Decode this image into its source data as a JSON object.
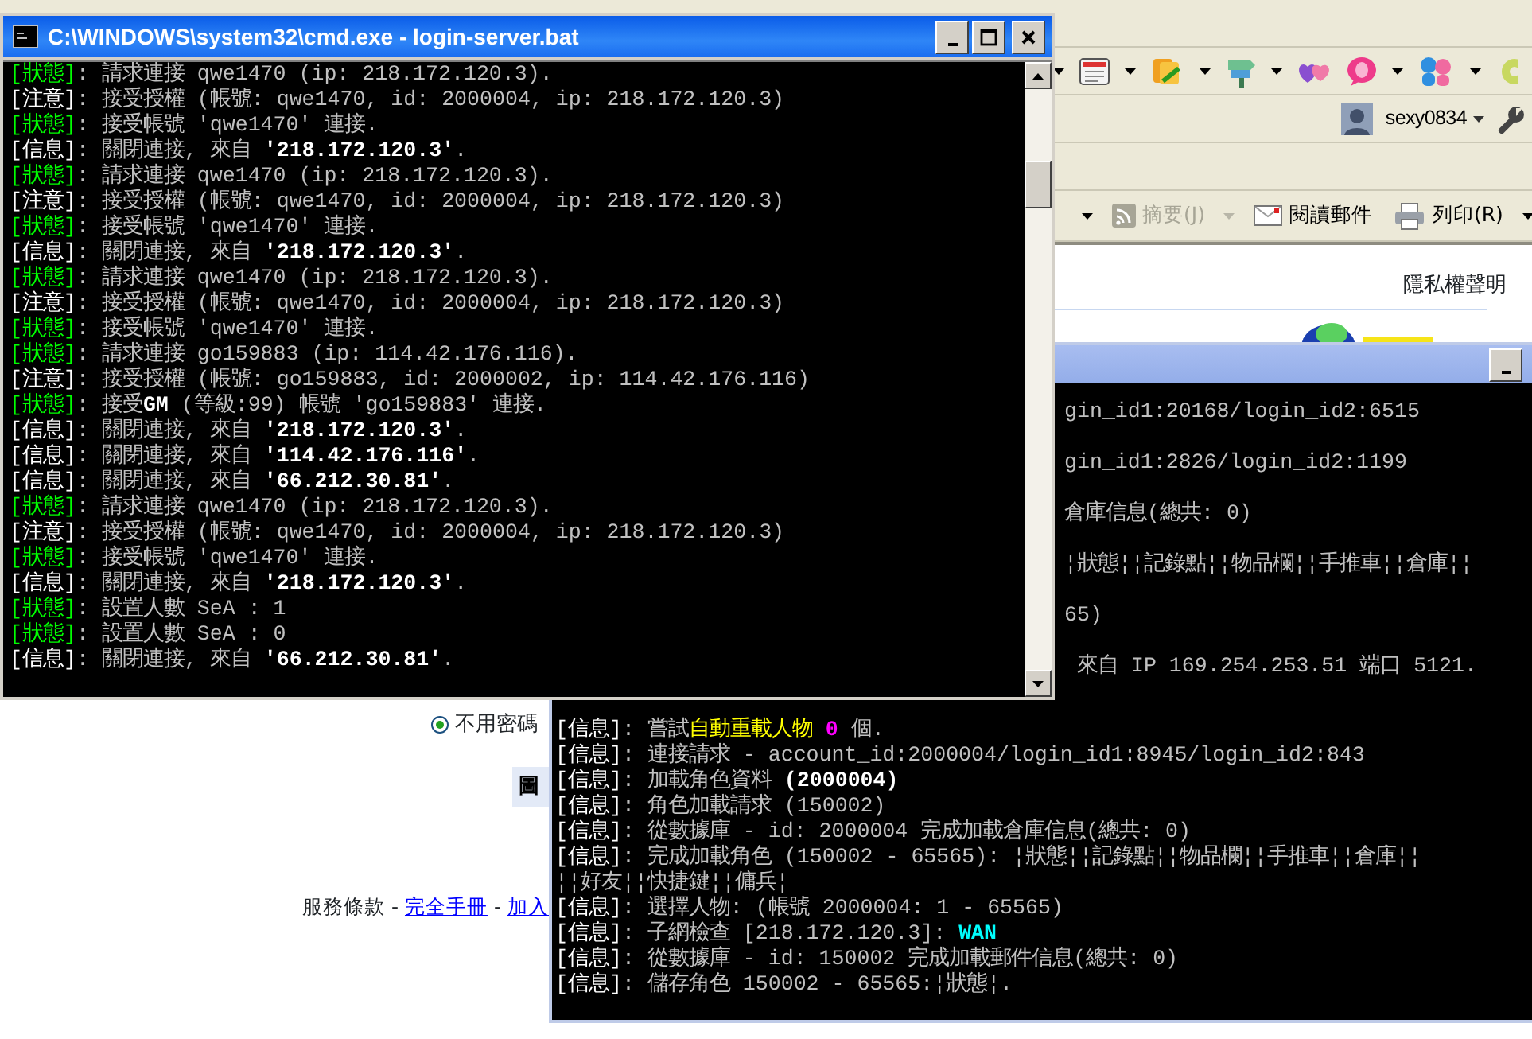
{
  "browser": {
    "user": "sexy0834",
    "commands": [
      {
        "label": "摘要(J)",
        "disabled": true
      },
      {
        "label": "閱讀郵件",
        "disabled": false
      },
      {
        "label": "列印(R)",
        "disabled": false
      }
    ],
    "privacy_link": "隱私權聲明",
    "login_option": {
      "label": "不用密碼",
      "selected": true
    },
    "button_fragment": "圖",
    "footer": {
      "separator": "-",
      "items": [
        {
          "text": "服務條款",
          "kind": "text"
        },
        {
          "text": "完全手冊",
          "kind": "link"
        },
        {
          "text": "加入",
          "kind": "link"
        }
      ]
    }
  },
  "console_back": {
    "active": false,
    "fragments": [
      "gin_id1:20168/login_id2:6515",
      "gin_id1:2826/login_id2:1199",
      "倉庫信息(總共: 0)",
      "¦狀態¦¦記錄點¦¦物品欄¦¦手推車¦¦倉庫¦¦",
      "65)",
      " 來自 IP 169.254.253.51 端口 5121."
    ],
    "lines": [
      {
        "tag": "[信息]",
        "kind": "info",
        "parts": [
          {
            "text": ": 嘗試"
          },
          {
            "text": "自動重載人物 ",
            "color": "#ffff00"
          },
          {
            "text": "0",
            "color": "#ff00ff",
            "bold": true
          },
          {
            "text": " 個."
          }
        ]
      },
      {
        "tag": "[信息]",
        "kind": "info",
        "parts": [
          {
            "text": ": 連接請求 - account_id:2000004/login_id1:8945/login_id2:843"
          }
        ]
      },
      {
        "tag": "[信息]",
        "kind": "info",
        "parts": [
          {
            "text": ": 加載角色資料 "
          },
          {
            "text": "(2000004)",
            "color": "#ffffff",
            "bold": true
          }
        ]
      },
      {
        "tag": "[信息]",
        "kind": "info",
        "parts": [
          {
            "text": ": 角色加載請求 (150002)"
          }
        ]
      },
      {
        "tag": "[信息]",
        "kind": "info",
        "parts": [
          {
            "text": ": 從數據庫 - id: 2000004 完成加載倉庫信息(總共: 0)"
          }
        ]
      },
      {
        "tag": "[信息]",
        "kind": "info",
        "parts": [
          {
            "text": ": 完成加載角色 (150002 - 65565): ¦狀態¦¦記錄點¦¦物品欄¦¦手推車¦¦倉庫¦¦"
          }
        ]
      },
      {
        "kind": "wrap",
        "parts": [
          {
            "text": "¦¦好友¦¦快捷鍵¦¦傭兵¦"
          }
        ]
      },
      {
        "tag": "[信息]",
        "kind": "info",
        "parts": [
          {
            "text": ": 選擇人物: (帳號 2000004: 1 - 65565)"
          }
        ]
      },
      {
        "tag": "[信息]",
        "kind": "info",
        "parts": [
          {
            "text": ": 子網檢查 [218.172.120.3]: "
          },
          {
            "text": "WAN",
            "color": "#00ffff",
            "bold": true
          }
        ]
      },
      {
        "tag": "[信息]",
        "kind": "info",
        "parts": [
          {
            "text": ": 從數據庫 - id: 150002 完成加載郵件信息(總共: 0)"
          }
        ]
      },
      {
        "tag": "[信息]",
        "kind": "info",
        "parts": [
          {
            "text": ": 儲存角色 150002 - 65565:¦狀態¦."
          }
        ]
      }
    ]
  },
  "console_front": {
    "title": "C:\\WINDOWS\\system32\\cmd.exe - login-server.bat",
    "active": true,
    "lines": [
      {
        "tag": "[狀態]",
        "kind": "status",
        "parts": [
          {
            "text": ": 請求連接 qwe1470 (ip: 218.172.120.3)."
          }
        ]
      },
      {
        "tag": "[注意]",
        "kind": "notice",
        "parts": [
          {
            "text": ": 接受授權 (帳號: qwe1470, id: 2000004, ip: 218.172.120.3)"
          }
        ]
      },
      {
        "tag": "[狀態]",
        "kind": "status",
        "parts": [
          {
            "text": ": 接受帳號 'qwe1470' 連接."
          }
        ]
      },
      {
        "tag": "[信息]",
        "kind": "info",
        "parts": [
          {
            "text": ": 關閉連接, 來自 "
          },
          {
            "text": "'218.172.120.3'",
            "color": "#ffffff",
            "bold": true
          },
          {
            "text": "."
          }
        ]
      },
      {
        "tag": "[狀態]",
        "kind": "status",
        "parts": [
          {
            "text": ": 請求連接 qwe1470 (ip: 218.172.120.3)."
          }
        ]
      },
      {
        "tag": "[注意]",
        "kind": "notice",
        "parts": [
          {
            "text": ": 接受授權 (帳號: qwe1470, id: 2000004, ip: 218.172.120.3)"
          }
        ]
      },
      {
        "tag": "[狀態]",
        "kind": "status",
        "parts": [
          {
            "text": ": 接受帳號 'qwe1470' 連接."
          }
        ]
      },
      {
        "tag": "[信息]",
        "kind": "info",
        "parts": [
          {
            "text": ": 關閉連接, 來自 "
          },
          {
            "text": "'218.172.120.3'",
            "color": "#ffffff",
            "bold": true
          },
          {
            "text": "."
          }
        ]
      },
      {
        "tag": "[狀態]",
        "kind": "status",
        "parts": [
          {
            "text": ": 請求連接 qwe1470 (ip: 218.172.120.3)."
          }
        ]
      },
      {
        "tag": "[注意]",
        "kind": "notice",
        "parts": [
          {
            "text": ": 接受授權 (帳號: qwe1470, id: 2000004, ip: 218.172.120.3)"
          }
        ]
      },
      {
        "tag": "[狀態]",
        "kind": "status",
        "parts": [
          {
            "text": ": 接受帳號 'qwe1470' 連接."
          }
        ]
      },
      {
        "tag": "[狀態]",
        "kind": "status",
        "parts": [
          {
            "text": ": 請求連接 go159883 (ip: 114.42.176.116)."
          }
        ]
      },
      {
        "tag": "[注意]",
        "kind": "notice",
        "parts": [
          {
            "text": ": 接受授權 (帳號: go159883, id: 2000002, ip: 114.42.176.116)"
          }
        ]
      },
      {
        "tag": "[狀態]",
        "kind": "status",
        "parts": [
          {
            "text": ": 接受"
          },
          {
            "text": "GM",
            "color": "#ffffff",
            "bold": true
          },
          {
            "text": " (等級:99) 帳號 'go159883' 連接."
          }
        ]
      },
      {
        "tag": "[信息]",
        "kind": "info",
        "parts": [
          {
            "text": ": 關閉連接, 來自 "
          },
          {
            "text": "'218.172.120.3'",
            "color": "#ffffff",
            "bold": true
          },
          {
            "text": "."
          }
        ]
      },
      {
        "tag": "[信息]",
        "kind": "info",
        "parts": [
          {
            "text": ": 關閉連接, 來自 "
          },
          {
            "text": "'114.42.176.116'",
            "color": "#ffffff",
            "bold": true
          },
          {
            "text": "."
          }
        ]
      },
      {
        "tag": "[信息]",
        "kind": "info",
        "parts": [
          {
            "text": ": 關閉連接, 來自 "
          },
          {
            "text": "'66.212.30.81'",
            "color": "#ffffff",
            "bold": true
          },
          {
            "text": "."
          }
        ]
      },
      {
        "tag": "[狀態]",
        "kind": "status",
        "parts": [
          {
            "text": ": 請求連接 qwe1470 (ip: 218.172.120.3)."
          }
        ]
      },
      {
        "tag": "[注意]",
        "kind": "notice",
        "parts": [
          {
            "text": ": 接受授權 (帳號: qwe1470, id: 2000004, ip: 218.172.120.3)"
          }
        ]
      },
      {
        "tag": "[狀態]",
        "kind": "status",
        "parts": [
          {
            "text": ": 接受帳號 'qwe1470' 連接."
          }
        ]
      },
      {
        "tag": "[信息]",
        "kind": "info",
        "parts": [
          {
            "text": ": 關閉連接, 來自 "
          },
          {
            "text": "'218.172.120.3'",
            "color": "#ffffff",
            "bold": true
          },
          {
            "text": "."
          }
        ]
      },
      {
        "tag": "[狀態]",
        "kind": "status",
        "parts": [
          {
            "text": ": 設置人數 SeA : 1"
          }
        ]
      },
      {
        "tag": "[狀態]",
        "kind": "status",
        "parts": [
          {
            "text": ": 設置人數 SeA : 0"
          }
        ]
      },
      {
        "tag": "[信息]",
        "kind": "info",
        "parts": [
          {
            "text": ": 關閉連接, 來自 "
          },
          {
            "text": "'66.212.30.81'",
            "color": "#ffffff",
            "bold": true
          },
          {
            "text": "."
          }
        ]
      }
    ]
  }
}
